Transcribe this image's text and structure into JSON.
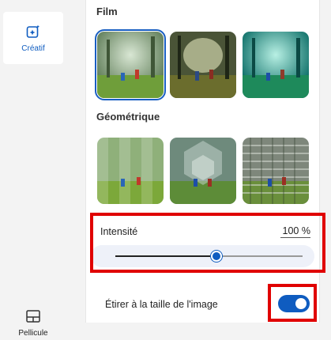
{
  "rail": {
    "items": [
      {
        "label": "Créatif",
        "icon": "sparkle-image-icon",
        "active": true
      },
      {
        "label": "Pellicule",
        "icon": "filmstrip-icon",
        "active": false
      }
    ]
  },
  "sections": {
    "film": {
      "title": "Film",
      "thumbs": [
        "film-filter-1",
        "film-filter-2",
        "film-filter-3"
      ],
      "selected_index": 0
    },
    "geometric": {
      "title": "Géométrique",
      "thumbs": [
        "geo-filter-1",
        "geo-filter-2",
        "geo-filter-3"
      ]
    }
  },
  "intensity": {
    "label": "Intensité",
    "value": "100",
    "unit": "%",
    "slider_fraction": 0.54
  },
  "stretch": {
    "label": "Étirer à la taille de l'image",
    "enabled": true
  },
  "colors": {
    "accent": "#0f5cc0",
    "highlight": "#e00000",
    "slider_bg": "#eef1f9"
  }
}
